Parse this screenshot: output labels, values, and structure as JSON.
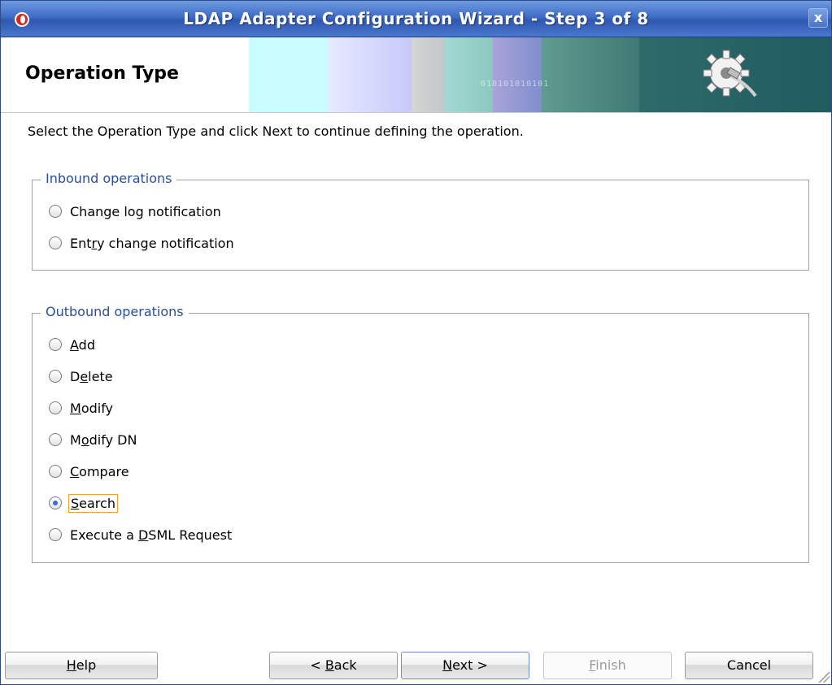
{
  "window": {
    "title": "LDAP Adapter Configuration Wizard - Step 3 of 8",
    "close_label": "x"
  },
  "header": {
    "step_title": "Operation Type",
    "banner_bits": "010101010101"
  },
  "instructions": "Select the Operation Type and click Next to continue defining the operation.",
  "inbound": {
    "legend": "Inbound operations",
    "options": [
      {
        "pre": "Chan",
        "u": "g",
        "post": "e log notification",
        "checked": false
      },
      {
        "pre": "Ent",
        "u": "r",
        "post": "y change notification",
        "checked": false
      }
    ]
  },
  "outbound": {
    "legend": "Outbound operations",
    "options": [
      {
        "pre": "",
        "u": "A",
        "post": "dd",
        "checked": false
      },
      {
        "pre": "D",
        "u": "e",
        "post": "lete",
        "checked": false
      },
      {
        "pre": "",
        "u": "M",
        "post": "odify",
        "checked": false
      },
      {
        "pre": "M",
        "u": "o",
        "post": "dify DN",
        "checked": false
      },
      {
        "pre": "",
        "u": "C",
        "post": "ompare",
        "checked": false
      },
      {
        "pre": "",
        "u": "S",
        "post": "earch",
        "checked": true
      },
      {
        "pre": "Execute a ",
        "u": "D",
        "post": "SML Request",
        "checked": false
      }
    ]
  },
  "buttons": {
    "help": {
      "pre": "",
      "u": "H",
      "post": "elp"
    },
    "back": {
      "pre": "< ",
      "u": "B",
      "post": "ack"
    },
    "next": {
      "pre": "",
      "u": "N",
      "post": "ext >"
    },
    "finish": {
      "pre": "",
      "u": "F",
      "post": "inish"
    },
    "cancel": {
      "pre": "",
      "u": "",
      "post": "Cancel"
    }
  }
}
